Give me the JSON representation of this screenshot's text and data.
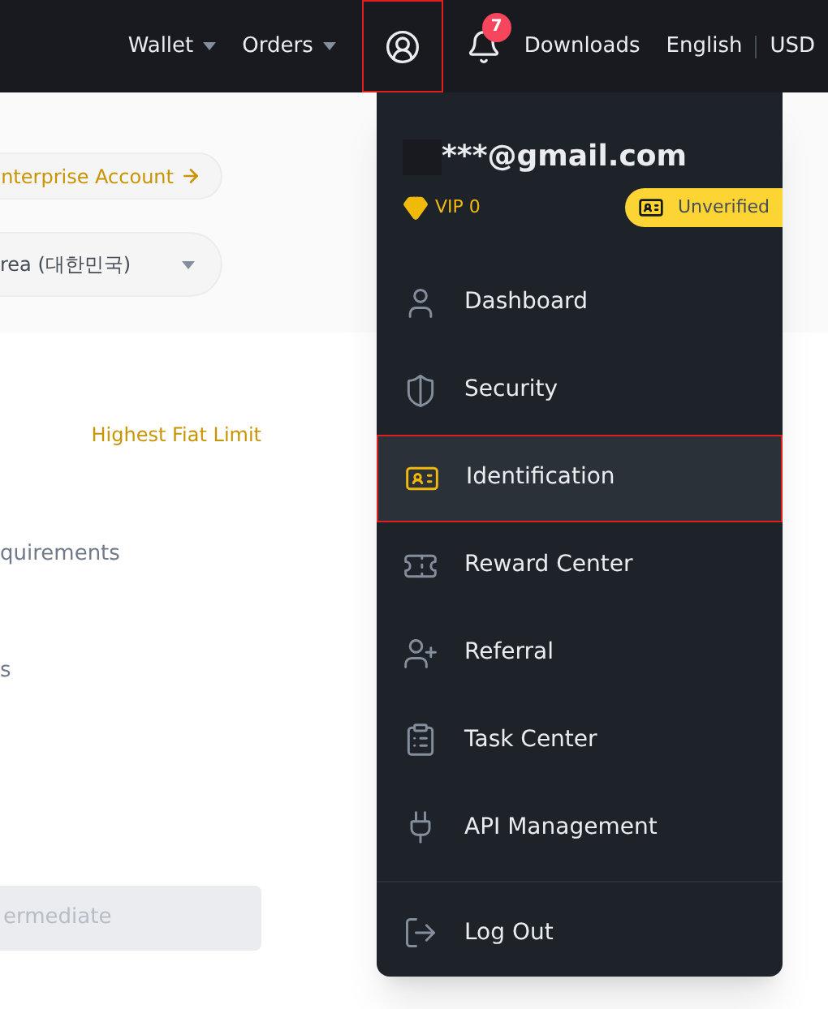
{
  "header": {
    "nav": [
      {
        "label": "Wallet",
        "dropdown": true
      },
      {
        "label": "Orders",
        "dropdown": true
      }
    ],
    "profile_menu_open": true,
    "notifications": {
      "count": "7"
    },
    "links": [
      "Downloads",
      "English",
      "USD"
    ]
  },
  "page": {
    "enterprise_link": "nterprise Account",
    "region_select": "rea (대한민국)",
    "highest_limit": "Highest Fiat Limit",
    "requirements": "quirements",
    "line": "s",
    "button": {
      "label": "ermediate",
      "disabled": true
    }
  },
  "account_menu": {
    "email": "***@gmail.com",
    "vip": "VIP 0",
    "status": "Unverified",
    "items": [
      {
        "label": "Dashboard",
        "kind": "user",
        "selected": false
      },
      {
        "label": "Security",
        "kind": "shield",
        "selected": false
      },
      {
        "label": "Identification",
        "kind": "card",
        "selected": true
      },
      {
        "label": "Reward Center",
        "kind": "ticket",
        "selected": false
      },
      {
        "label": "Referral",
        "kind": "invite",
        "selected": false
      },
      {
        "label": "Task Center",
        "kind": "clipboard",
        "selected": false
      },
      {
        "label": "API Management",
        "kind": "plug",
        "selected": false
      }
    ],
    "footer_item": {
      "label": "Log Out",
      "kind": "logout",
      "selected": false
    }
  }
}
